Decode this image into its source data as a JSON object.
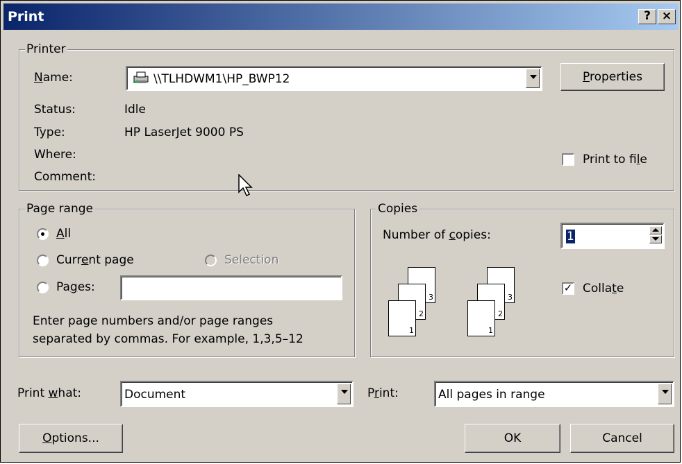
{
  "window": {
    "title": "Print",
    "help": "?",
    "close": "×"
  },
  "printer": {
    "legend": "Printer",
    "name_label": "Name:",
    "name_value": "\\\\TLHDWM1\\HP_BWP12",
    "properties": "Properties",
    "status_label": "Status:",
    "status_value": "Idle",
    "type_label": "Type:",
    "type_value": "HP LaserJet 9000 PS",
    "where_label": "Where:",
    "comment_label": "Comment:",
    "print_to_file": "Print to file",
    "print_to_file_checked": false
  },
  "page_range": {
    "legend": "Page range",
    "all": "All",
    "current_page": "Current page",
    "selection": "Selection",
    "pages": "Pages:",
    "pages_value": "",
    "hint_line1": "Enter page numbers and/or page ranges",
    "hint_line2": "separated by commas.  For example, 1,3,5–12",
    "selected": "all"
  },
  "copies": {
    "legend": "Copies",
    "number_label": "Number of copies:",
    "number_value": "1",
    "collate": "Collate",
    "collate_checked": true,
    "page_numbers": [
      "1",
      "2",
      "3"
    ]
  },
  "print_what": {
    "label": "Print what:",
    "value": "Document"
  },
  "print": {
    "label": "Print:",
    "value": "All pages in range"
  },
  "buttons": {
    "options": "Options...",
    "ok": "OK",
    "cancel": "Cancel"
  }
}
